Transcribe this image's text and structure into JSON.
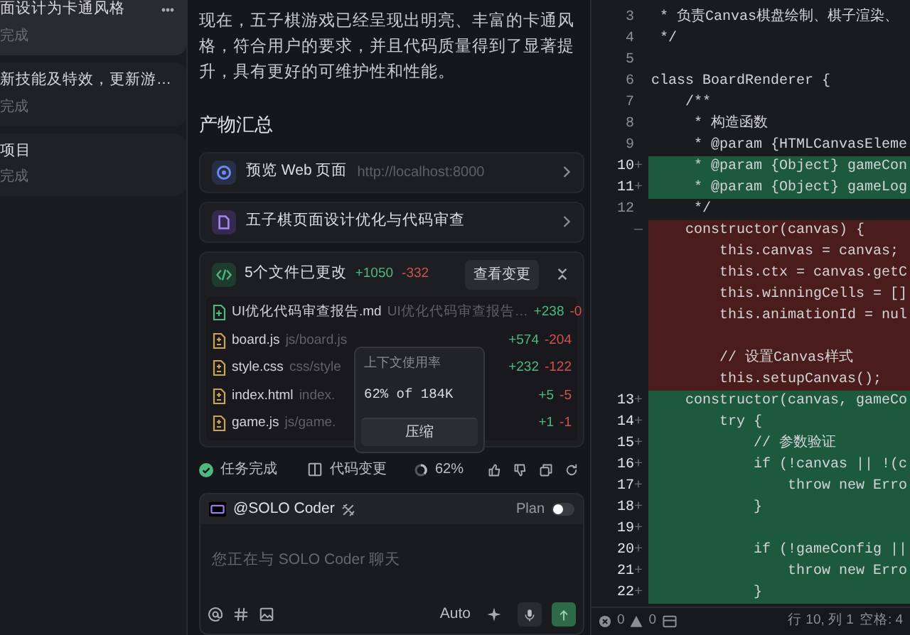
{
  "sidebar": {
    "tasks": [
      {
        "title": "面设计为卡通风格",
        "status": "完成",
        "selected": true
      },
      {
        "title": "新技能及特效，更新游…",
        "status": "完成",
        "selected": false
      },
      {
        "title": "项目",
        "status": "完成",
        "selected": false
      }
    ]
  },
  "chat": {
    "summary": "现在，五子棋游戏已经呈现出明亮、丰富的卡通风格，符合用户的要求，并且代码质量得到了显著提升，具有更好的可维护性和性能。",
    "artifacts_heading": "产物汇总",
    "preview": {
      "label": "预览 Web 页面",
      "url": "http://localhost:8000"
    },
    "document": {
      "title": "五子棋页面设计优化与代码审查"
    },
    "changes": {
      "title": "5个文件已更改",
      "added": "+1050",
      "removed": "-332",
      "view_button": "查看变更",
      "expanded": true,
      "files": [
        {
          "name": "UI优化代码审查报告.md",
          "path": "UI优化代码审查报告…",
          "added": "+238",
          "removed": "-0",
          "kind": "new"
        },
        {
          "name": "board.js",
          "path": "js/board.js",
          "added": "+574",
          "removed": "-204",
          "kind": "modified"
        },
        {
          "name": "style.css",
          "path": "css/style",
          "added": "+232",
          "removed": "-122",
          "kind": "modified"
        },
        {
          "name": "index.html",
          "path": "index.",
          "added": "+5",
          "removed": "-5",
          "kind": "modified"
        },
        {
          "name": "game.js",
          "path": "js/game.",
          "added": "+1",
          "removed": "-1",
          "kind": "modified"
        }
      ]
    },
    "context_popup": {
      "title": "上下文使用率",
      "usage": "62% of 184K",
      "button": "压缩"
    },
    "status": {
      "done": "任务完成",
      "code_changes": "代码变更",
      "context": "62%"
    },
    "composer": {
      "agent": "@SOLO Coder",
      "plan_label": "Plan",
      "plan_on": false,
      "placeholder": "您正在与 SOLO Coder 聊天",
      "mode": "Auto"
    }
  },
  "editor": {
    "lines": [
      {
        "number": "3",
        "kind": "normal",
        "text": " * 负责Canvas棋盘绘制、棋子渲染、"
      },
      {
        "number": "4",
        "kind": "normal",
        "text": " */"
      },
      {
        "number": "5",
        "kind": "normal"
      },
      {
        "number": "6",
        "kind": "normal",
        "text": "class BoardRenderer {"
      },
      {
        "number": "7",
        "kind": "normal",
        "text": "    /**"
      },
      {
        "number": "8",
        "kind": "normal",
        "text": "     * 构造函数"
      },
      {
        "number": "9",
        "kind": "normal",
        "text": "     * @param {HTMLCanvasEleme"
      },
      {
        "number": "10",
        "marker": "+",
        "kind": "added",
        "text": "     * @param {Object} gameCon"
      },
      {
        "number": "11",
        "marker": "+",
        "kind": "added",
        "text": "     * @param {Object} gameLog"
      },
      {
        "number": "12",
        "kind": "normal",
        "text": "     */"
      },
      {
        "marker": "—",
        "kind": "removed",
        "text": "    constructor(canvas) {"
      },
      {
        "kind": "removed",
        "text": "        this.canvas = canvas;"
      },
      {
        "kind": "removed",
        "text": "        this.ctx = canvas.getC"
      },
      {
        "kind": "removed",
        "text": "        this.winningCells = []"
      },
      {
        "kind": "removed",
        "text": "        this.animationId = nul"
      },
      {
        "kind": "removed"
      },
      {
        "kind": "removed",
        "text": "        // 设置Canvas样式"
      },
      {
        "kind": "removed",
        "text": "        this.setupCanvas();"
      },
      {
        "number": "13",
        "marker": "+",
        "kind": "added",
        "text": "    constructor(canvas, gameCo"
      },
      {
        "number": "14",
        "marker": "+",
        "kind": "added",
        "text": "        try {"
      },
      {
        "number": "15",
        "marker": "+",
        "kind": "added",
        "text": "            // 参数验证"
      },
      {
        "number": "16",
        "marker": "+",
        "kind": "added",
        "text": "            if (!canvas || !(c"
      },
      {
        "number": "17",
        "marker": "+",
        "kind": "added",
        "text": "                throw new Erro"
      },
      {
        "number": "18",
        "marker": "+",
        "kind": "added",
        "text": "            }"
      },
      {
        "number": "19",
        "marker": "+",
        "kind": "added"
      },
      {
        "number": "20",
        "marker": "+",
        "kind": "added",
        "text": "            if (!gameConfig ||"
      },
      {
        "number": "21",
        "marker": "+",
        "kind": "added",
        "text": "                throw new Erro"
      },
      {
        "number": "22",
        "marker": "+",
        "kind": "added",
        "text": "            }"
      }
    ],
    "status_bar": {
      "errors": "0",
      "warnings": "0",
      "position": "行 10, 列 1",
      "indent": "空格: 4"
    }
  }
}
